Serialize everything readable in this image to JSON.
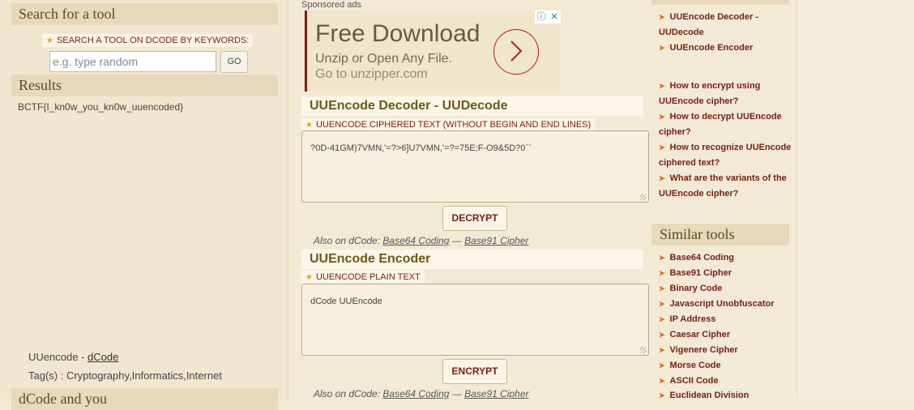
{
  "search": {
    "title": "Search for a tool",
    "keywords_label": "SEARCH A TOOL ON DCODE BY KEYWORDS:",
    "placeholder": "e.g. type random",
    "go_label": "GO"
  },
  "results": {
    "title": "Results",
    "value": "BCTF{I_kn0w_you_kn0w_uuencoded}"
  },
  "footer_left": {
    "tool_name": "UUencode - ",
    "dcode_link": "dCode",
    "tags": "Tag(s) : Cryptography,Informatics,Internet",
    "next_title": "dCode and you"
  },
  "ad": {
    "sponsored": "Sponsored ads",
    "title": "Free Download",
    "subtitle": "Unzip or Open Any File.",
    "url": "Go to unzipper.com"
  },
  "decoder": {
    "title": "UUEncode Decoder - UUDecode",
    "label": "UUENCODE CIPHERED TEXT (WITHOUT BEGIN AND END LINES)",
    "value": "?0D-41GM)7VMN,'=?>6]U7VMN,'=?=75E;F-O9&5D?0``",
    "button": "DECRYPT",
    "also_prefix": "Also on dCode: ",
    "also_1": "Base64 Coding",
    "also_sep": " — ",
    "also_2": "Base91 Cipher"
  },
  "encoder": {
    "title": "UUEncode Encoder",
    "label": "UUENCODE PLAIN TEXT",
    "value": "dCode UUEncode",
    "button": "ENCRYPT",
    "also_prefix": "Also on dCode: ",
    "also_1": "Base64 Coding",
    "also_sep": " — ",
    "also_2": "Base91 Cipher"
  },
  "sidebar": {
    "links": [
      {
        "line1": "UUEncode Decoder -",
        "line2": "UUDecode"
      },
      {
        "line1": "UUEncode Encoder",
        "line2": ""
      },
      {
        "line1": "How to encrypt using",
        "line2": "UUEncode cipher?"
      },
      {
        "line1": "How to decrypt UUEncode",
        "line2": "cipher?"
      },
      {
        "line1": "How to recognize UUEncode",
        "line2": "ciphered text?"
      },
      {
        "line1": "What are the variants of the",
        "line2": "UUEncode cipher?"
      }
    ],
    "similar_title": "Similar tools",
    "similar": [
      "Base64 Coding",
      "Base91 Cipher",
      "Binary Code",
      "Javascript Unobfuscator",
      "IP Address",
      "Caesar Cipher",
      "Vigenere Cipher",
      "Morse Code",
      "ASCII Code",
      "Euclidean Division"
    ]
  },
  "colors": {
    "accent": "#7a1d10",
    "panel": "#e7d9b9",
    "heading": "#6a5a14",
    "bullet": "#e06a10"
  },
  "icons": {
    "star": "star-icon",
    "bullet": "arrow-bullet-icon",
    "ad_info": "info-icon",
    "ad_close": "close-icon",
    "ad_arrow": "chevron-right-icon"
  }
}
